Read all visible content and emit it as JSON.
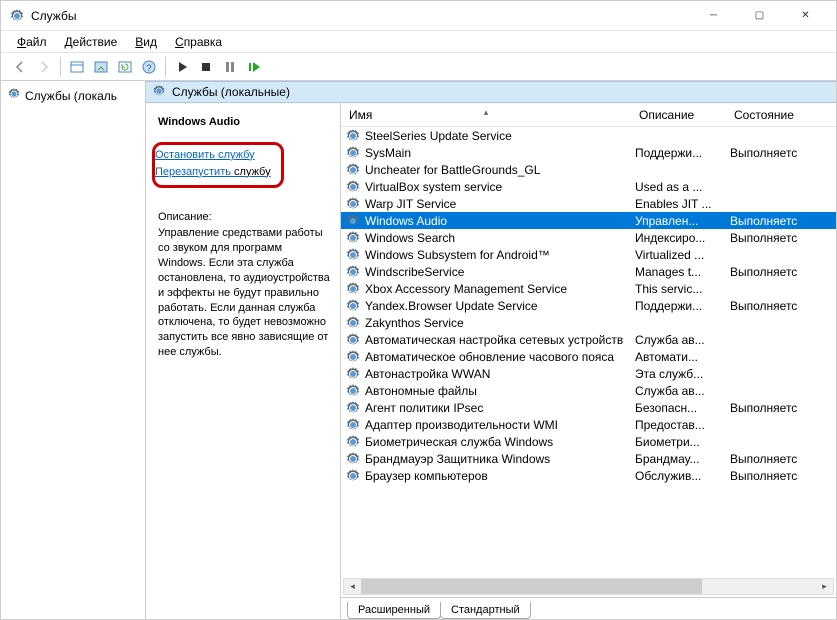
{
  "window": {
    "title": "Службы"
  },
  "menu": {
    "file": "Файл",
    "action": "Действие",
    "view": "Вид",
    "help": "Справка"
  },
  "tree": {
    "root": "Службы (локаль"
  },
  "pane": {
    "title": "Службы (локальные)"
  },
  "detail": {
    "selected_service": "Windows Audio",
    "stop_label": "Остановить службу",
    "restart_prefix": "Перезапустить",
    "restart_suffix": " службу",
    "desc_label": "Описание:",
    "desc_text": "Управление средствами работы со звуком для программ Windows.  Если эта служба остановлена, то аудиоустройства и эффекты не будут правильно работать.  Если данная служба отключена, то будет невозможно запустить все явно зависящие от нее службы."
  },
  "columns": {
    "name": "Имя",
    "desc": "Описание",
    "state": "Состояние"
  },
  "services": [
    {
      "name": "SteelSeries Update Service",
      "desc": "",
      "state": ""
    },
    {
      "name": "SysMain",
      "desc": "Поддержи...",
      "state": "Выполняетс"
    },
    {
      "name": "Uncheater for BattleGrounds_GL",
      "desc": "",
      "state": ""
    },
    {
      "name": "VirtualBox system service",
      "desc": "Used as a ...",
      "state": ""
    },
    {
      "name": "Warp JIT Service",
      "desc": "Enables JIT ...",
      "state": ""
    },
    {
      "name": "Windows Audio",
      "desc": "Управлен...",
      "state": "Выполняетс",
      "selected": true
    },
    {
      "name": "Windows Search",
      "desc": "Индексиро...",
      "state": "Выполняетс"
    },
    {
      "name": "Windows Subsystem for Android™",
      "desc": "Virtualized ...",
      "state": ""
    },
    {
      "name": "WindscribeService",
      "desc": "Manages t...",
      "state": "Выполняетс"
    },
    {
      "name": "Xbox Accessory Management Service",
      "desc": "This servic...",
      "state": ""
    },
    {
      "name": "Yandex.Browser Update Service",
      "desc": "Поддержи...",
      "state": "Выполняетс"
    },
    {
      "name": "Zakynthos Service",
      "desc": "",
      "state": ""
    },
    {
      "name": "Автоматическая настройка сетевых устройств",
      "desc": "Служба ав...",
      "state": ""
    },
    {
      "name": "Автоматическое обновление часового пояса",
      "desc": "Автомати...",
      "state": ""
    },
    {
      "name": "Автонастройка WWAN",
      "desc": "Эта служб...",
      "state": ""
    },
    {
      "name": "Автономные файлы",
      "desc": "Служба ав...",
      "state": ""
    },
    {
      "name": "Агент политики IPsec",
      "desc": "Безопасн...",
      "state": "Выполняетс"
    },
    {
      "name": "Адаптер производительности WMI",
      "desc": "Предостав...",
      "state": ""
    },
    {
      "name": "Биометрическая служба Windows",
      "desc": "Биометри...",
      "state": ""
    },
    {
      "name": "Брандмауэр Защитника Windows",
      "desc": "Брандмау...",
      "state": "Выполняетс"
    },
    {
      "name": "Браузер компьютеров",
      "desc": "Обслужив...",
      "state": "Выполняетс"
    }
  ],
  "tabs": {
    "extended": "Расширенный",
    "standard": "Стандартный"
  }
}
